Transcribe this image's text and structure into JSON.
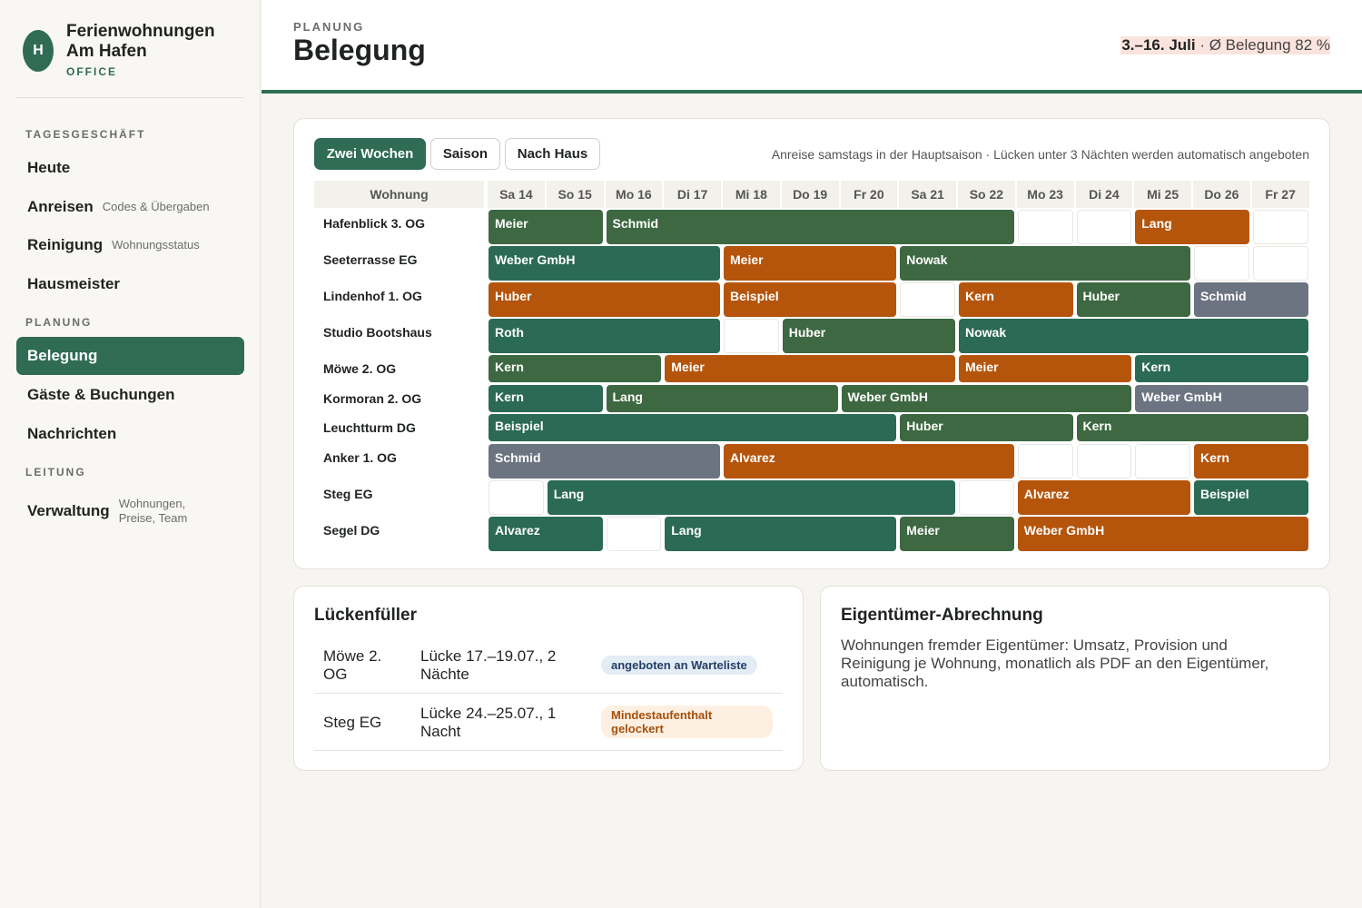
{
  "brand": {
    "initial": "H",
    "name": "Ferienwohnungen Am Hafen",
    "sub": "OFFICE"
  },
  "sidebar": {
    "sections": [
      {
        "title": "TAGESGESCHÄFT",
        "items": [
          {
            "label": "Heute",
            "sub": ""
          },
          {
            "label": "Anreisen",
            "sub": "Codes & Übergaben"
          },
          {
            "label": "Reinigung",
            "sub": "Wohnungsstatus"
          },
          {
            "label": "Hausmeister",
            "sub": ""
          }
        ]
      },
      {
        "title": "PLANUNG",
        "items": [
          {
            "label": "Belegung",
            "sub": "",
            "active": true
          },
          {
            "label": "Gäste & Buchungen",
            "sub": ""
          },
          {
            "label": "Nachrichten",
            "sub": ""
          }
        ]
      },
      {
        "title": "LEITUNG",
        "items": [
          {
            "label": "Verwaltung",
            "sub": "Wohnungen, Preise, Team"
          }
        ]
      }
    ]
  },
  "header": {
    "kicker": "PLANUNG",
    "title": "Belegung",
    "range": "3.–16. Juli",
    "sep": " · ",
    "stat": "Ø Belegung 82 %"
  },
  "plan": {
    "views": [
      {
        "label": "Zwei Wochen",
        "active": true
      },
      {
        "label": "Saison"
      },
      {
        "label": "Nach Haus"
      }
    ],
    "hint": "Anreise samstags in der Hauptsaison · Lücken unter 3 Nächten werden automatisch angeboten",
    "col_label": "Wohnung",
    "days": [
      "Sa 14",
      "So 15",
      "Mo 16",
      "Di 17",
      "Mi 18",
      "Do 19",
      "Fr 20",
      "Sa 21",
      "So 22",
      "Mo 23",
      "Di 24",
      "Mi 25",
      "Do 26",
      "Fr 27"
    ],
    "status_colors": {
      "g1": "#3d6841",
      "g2": "#2b6a55",
      "o": "#b5550c",
      "s": "#6c7481"
    },
    "rows": [
      {
        "name": "Hafenblick 3. OG",
        "bookings": [
          {
            "guest": "Meier",
            "start": 0,
            "nights": 2,
            "color": "g1"
          },
          {
            "guest": "Schmid",
            "start": 2,
            "nights": 7,
            "color": "g1"
          },
          {
            "guest": "Lang",
            "start": 11,
            "nights": 2,
            "color": "o"
          }
        ]
      },
      {
        "name": "Seeterrasse EG",
        "bookings": [
          {
            "guest": "Weber GmbH",
            "start": 0,
            "nights": 4,
            "color": "g2"
          },
          {
            "guest": "Meier",
            "start": 4,
            "nights": 3,
            "color": "o"
          },
          {
            "guest": "Nowak",
            "start": 7,
            "nights": 5,
            "color": "g1"
          }
        ]
      },
      {
        "name": "Lindenhof 1. OG",
        "bookings": [
          {
            "guest": "Huber",
            "start": 0,
            "nights": 4,
            "color": "o"
          },
          {
            "guest": "Beispiel",
            "start": 4,
            "nights": 3,
            "color": "o"
          },
          {
            "guest": "Kern",
            "start": 8,
            "nights": 2,
            "color": "o"
          },
          {
            "guest": "Huber",
            "start": 10,
            "nights": 2,
            "color": "g1"
          },
          {
            "guest": "Schmid",
            "start": 12,
            "nights": 2,
            "color": "s"
          }
        ]
      },
      {
        "name": "Studio Bootshaus",
        "bookings": [
          {
            "guest": "Roth",
            "start": 0,
            "nights": 4,
            "color": "g2"
          },
          {
            "guest": "Huber",
            "start": 5,
            "nights": 3,
            "color": "g1"
          },
          {
            "guest": "Nowak",
            "start": 8,
            "nights": 6,
            "color": "g2"
          }
        ]
      },
      {
        "name": "Möwe 2. OG",
        "bookings": [
          {
            "guest": "Kern",
            "start": 0,
            "nights": 3,
            "color": "g1"
          },
          {
            "guest": "Meier",
            "start": 3,
            "nights": 5,
            "color": "o"
          },
          {
            "guest": "Meier",
            "start": 8,
            "nights": 3,
            "color": "o"
          },
          {
            "guest": "Kern",
            "start": 11,
            "nights": 3,
            "color": "g2"
          }
        ]
      },
      {
        "name": "Kormoran 2. OG",
        "bookings": [
          {
            "guest": "Kern",
            "start": 0,
            "nights": 2,
            "color": "g2"
          },
          {
            "guest": "Lang",
            "start": 2,
            "nights": 4,
            "color": "g1"
          },
          {
            "guest": "Weber GmbH",
            "start": 6,
            "nights": 5,
            "color": "g1"
          },
          {
            "guest": "Weber GmbH",
            "start": 11,
            "nights": 3,
            "color": "s"
          }
        ]
      },
      {
        "name": "Leuchtturm DG",
        "bookings": [
          {
            "guest": "Beispiel",
            "start": 0,
            "nights": 7,
            "color": "g2"
          },
          {
            "guest": "Huber",
            "start": 7,
            "nights": 3,
            "color": "g1"
          },
          {
            "guest": "Kern",
            "start": 10,
            "nights": 4,
            "color": "g1"
          }
        ]
      },
      {
        "name": "Anker 1. OG",
        "bookings": [
          {
            "guest": "Schmid",
            "start": 0,
            "nights": 4,
            "color": "s"
          },
          {
            "guest": "Alvarez",
            "start": 4,
            "nights": 5,
            "color": "o"
          },
          {
            "guest": "Kern",
            "start": 12,
            "nights": 2,
            "color": "o"
          }
        ]
      },
      {
        "name": "Steg EG",
        "bookings": [
          {
            "guest": "Lang",
            "start": 1,
            "nights": 7,
            "color": "g2"
          },
          {
            "guest": "Alvarez",
            "start": 9,
            "nights": 3,
            "color": "o"
          },
          {
            "guest": "Beispiel",
            "start": 12,
            "nights": 2,
            "color": "g2"
          }
        ]
      },
      {
        "name": "Segel DG",
        "bookings": [
          {
            "guest": "Alvarez",
            "start": 0,
            "nights": 2,
            "color": "g2"
          },
          {
            "guest": "Lang",
            "start": 3,
            "nights": 4,
            "color": "g2"
          },
          {
            "guest": "Meier",
            "start": 7,
            "nights": 2,
            "color": "g1"
          },
          {
            "guest": "Weber GmbH",
            "start": 9,
            "nights": 5,
            "color": "o"
          }
        ]
      }
    ]
  },
  "gaps": {
    "title": "Lückenfüller",
    "items": [
      {
        "unit": "Möwe 2. OG",
        "desc": "Lücke 17.–19.07., 2 Nächte",
        "badge": "angeboten an Warteliste",
        "badge_type": "blue"
      },
      {
        "unit": "Steg EG",
        "desc": "Lücke 24.–25.07., 1 Nacht",
        "badge": "Mindestaufenthalt gelockert",
        "badge_type": "orange"
      }
    ]
  },
  "owner": {
    "title": "Eigentümer-Abrechnung",
    "text": "Wohnungen fremder Eigentümer: Umsatz, Provision und Reinigung je Wohnung, monatlich als PDF an den Eigentümer, automatisch."
  }
}
